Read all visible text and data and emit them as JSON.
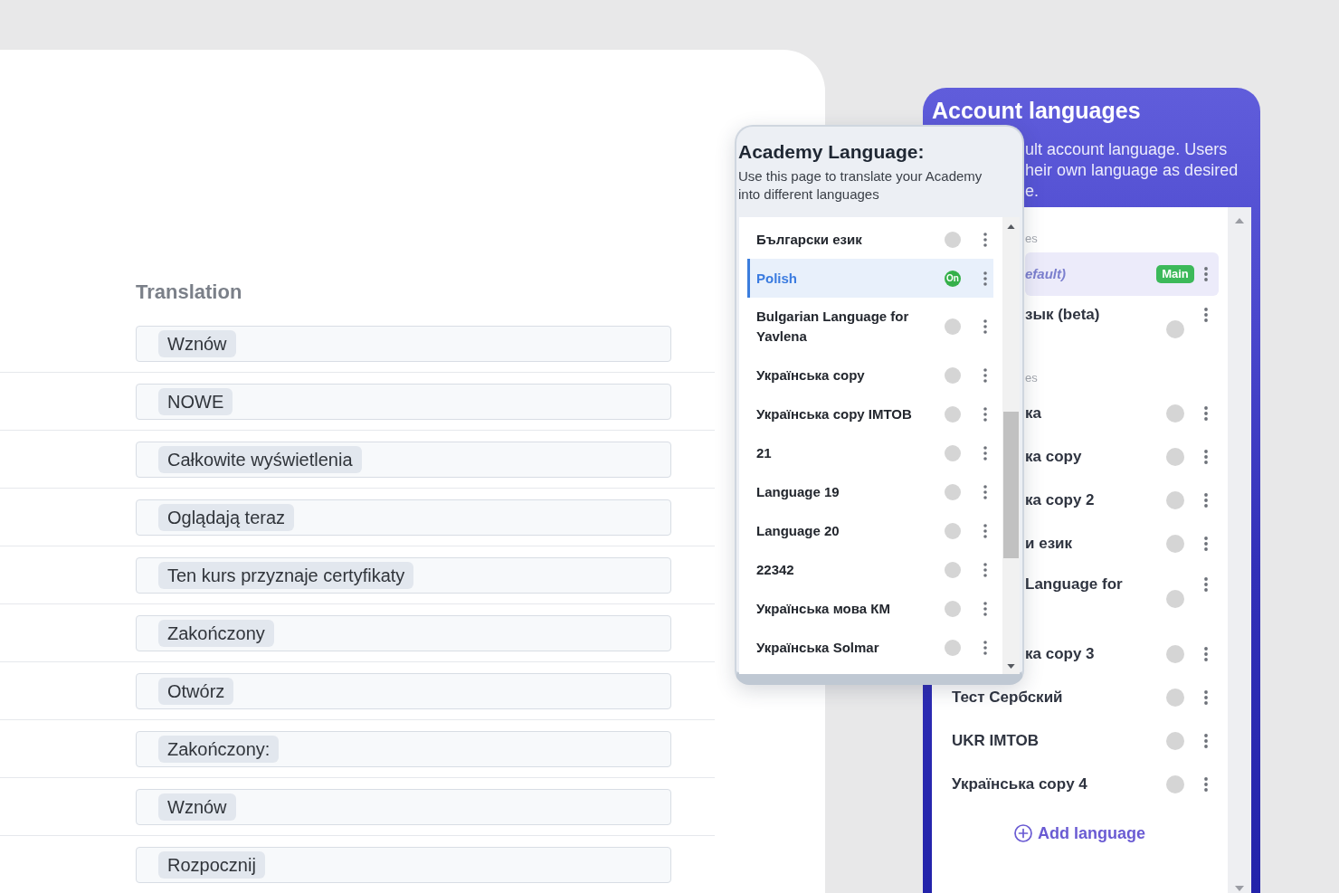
{
  "translation_table": {
    "heading": "Translation",
    "rows": [
      "Wznów",
      "NOWE",
      "Całkowite wyświetlenia",
      "Oglądają teraz",
      "Ten kurs przyznaje certyfikaty",
      "Zakończony",
      "Otwórz",
      "Zakończony:",
      "Wznów",
      "Rozpocznij"
    ]
  },
  "academy_language": {
    "title": "Academy Language:",
    "description": "Use this page to translate your Academy into different languages",
    "on_label": "On",
    "languages": [
      {
        "name": "Български език",
        "selected": false,
        "on": false
      },
      {
        "name": "Polish",
        "selected": true,
        "on": true
      },
      {
        "name": "Bulgarian Language for Yavlena",
        "selected": false,
        "on": false
      },
      {
        "name": "Українська copy",
        "selected": false,
        "on": false
      },
      {
        "name": "Українська copy IMTOB",
        "selected": false,
        "on": false
      },
      {
        "name": "21",
        "selected": false,
        "on": false
      },
      {
        "name": "Language 19",
        "selected": false,
        "on": false
      },
      {
        "name": "Language 20",
        "selected": false,
        "on": false
      },
      {
        "name": "22342",
        "selected": false,
        "on": false
      },
      {
        "name": "Українська мова КМ",
        "selected": false,
        "on": false
      },
      {
        "name": "Українська Solmar",
        "selected": false,
        "on": false
      }
    ]
  },
  "account_languages": {
    "title": "Account languages",
    "description_lines": [
      "ult account language. Users",
      "heir own language as desired",
      "e."
    ],
    "items": [
      {
        "kind": "section",
        "label": "es",
        "partly_hidden": true
      },
      {
        "kind": "default",
        "name": "efault)",
        "badge": "Main",
        "selected": true,
        "partly_hidden": true,
        "two_line": false
      },
      {
        "kind": "language",
        "name": "зык (beta)",
        "selected": false,
        "on": false,
        "partly_hidden": true,
        "two_line": true
      },
      {
        "kind": "section",
        "label": "es",
        "partly_hidden": true
      },
      {
        "kind": "language",
        "name": "ка",
        "selected": false,
        "on": false,
        "partly_hidden": true,
        "two_line": false
      },
      {
        "kind": "language",
        "name": "ка copy",
        "selected": false,
        "on": false,
        "partly_hidden": true,
        "two_line": false
      },
      {
        "kind": "language",
        "name": "ка copy 2",
        "selected": false,
        "on": false,
        "partly_hidden": true,
        "two_line": false
      },
      {
        "kind": "language",
        "name": "и език",
        "selected": false,
        "on": false,
        "partly_hidden": true,
        "two_line": false
      },
      {
        "kind": "language",
        "name": "Language for",
        "selected": false,
        "on": false,
        "partly_hidden": true,
        "two_line": true
      },
      {
        "kind": "language",
        "name": "ка copy 3",
        "selected": false,
        "on": false,
        "partly_hidden": true,
        "two_line": false
      },
      {
        "kind": "language",
        "name": "Тест Сербский",
        "selected": false,
        "on": false,
        "partly_hidden": false,
        "two_line": false
      },
      {
        "kind": "language",
        "name": "UKR IMTOB",
        "selected": false,
        "on": false,
        "partly_hidden": false,
        "two_line": false
      },
      {
        "kind": "language",
        "name": "Українська copy 4",
        "selected": false,
        "on": false,
        "partly_hidden": false,
        "two_line": false
      }
    ],
    "add_button": "Add language"
  }
}
